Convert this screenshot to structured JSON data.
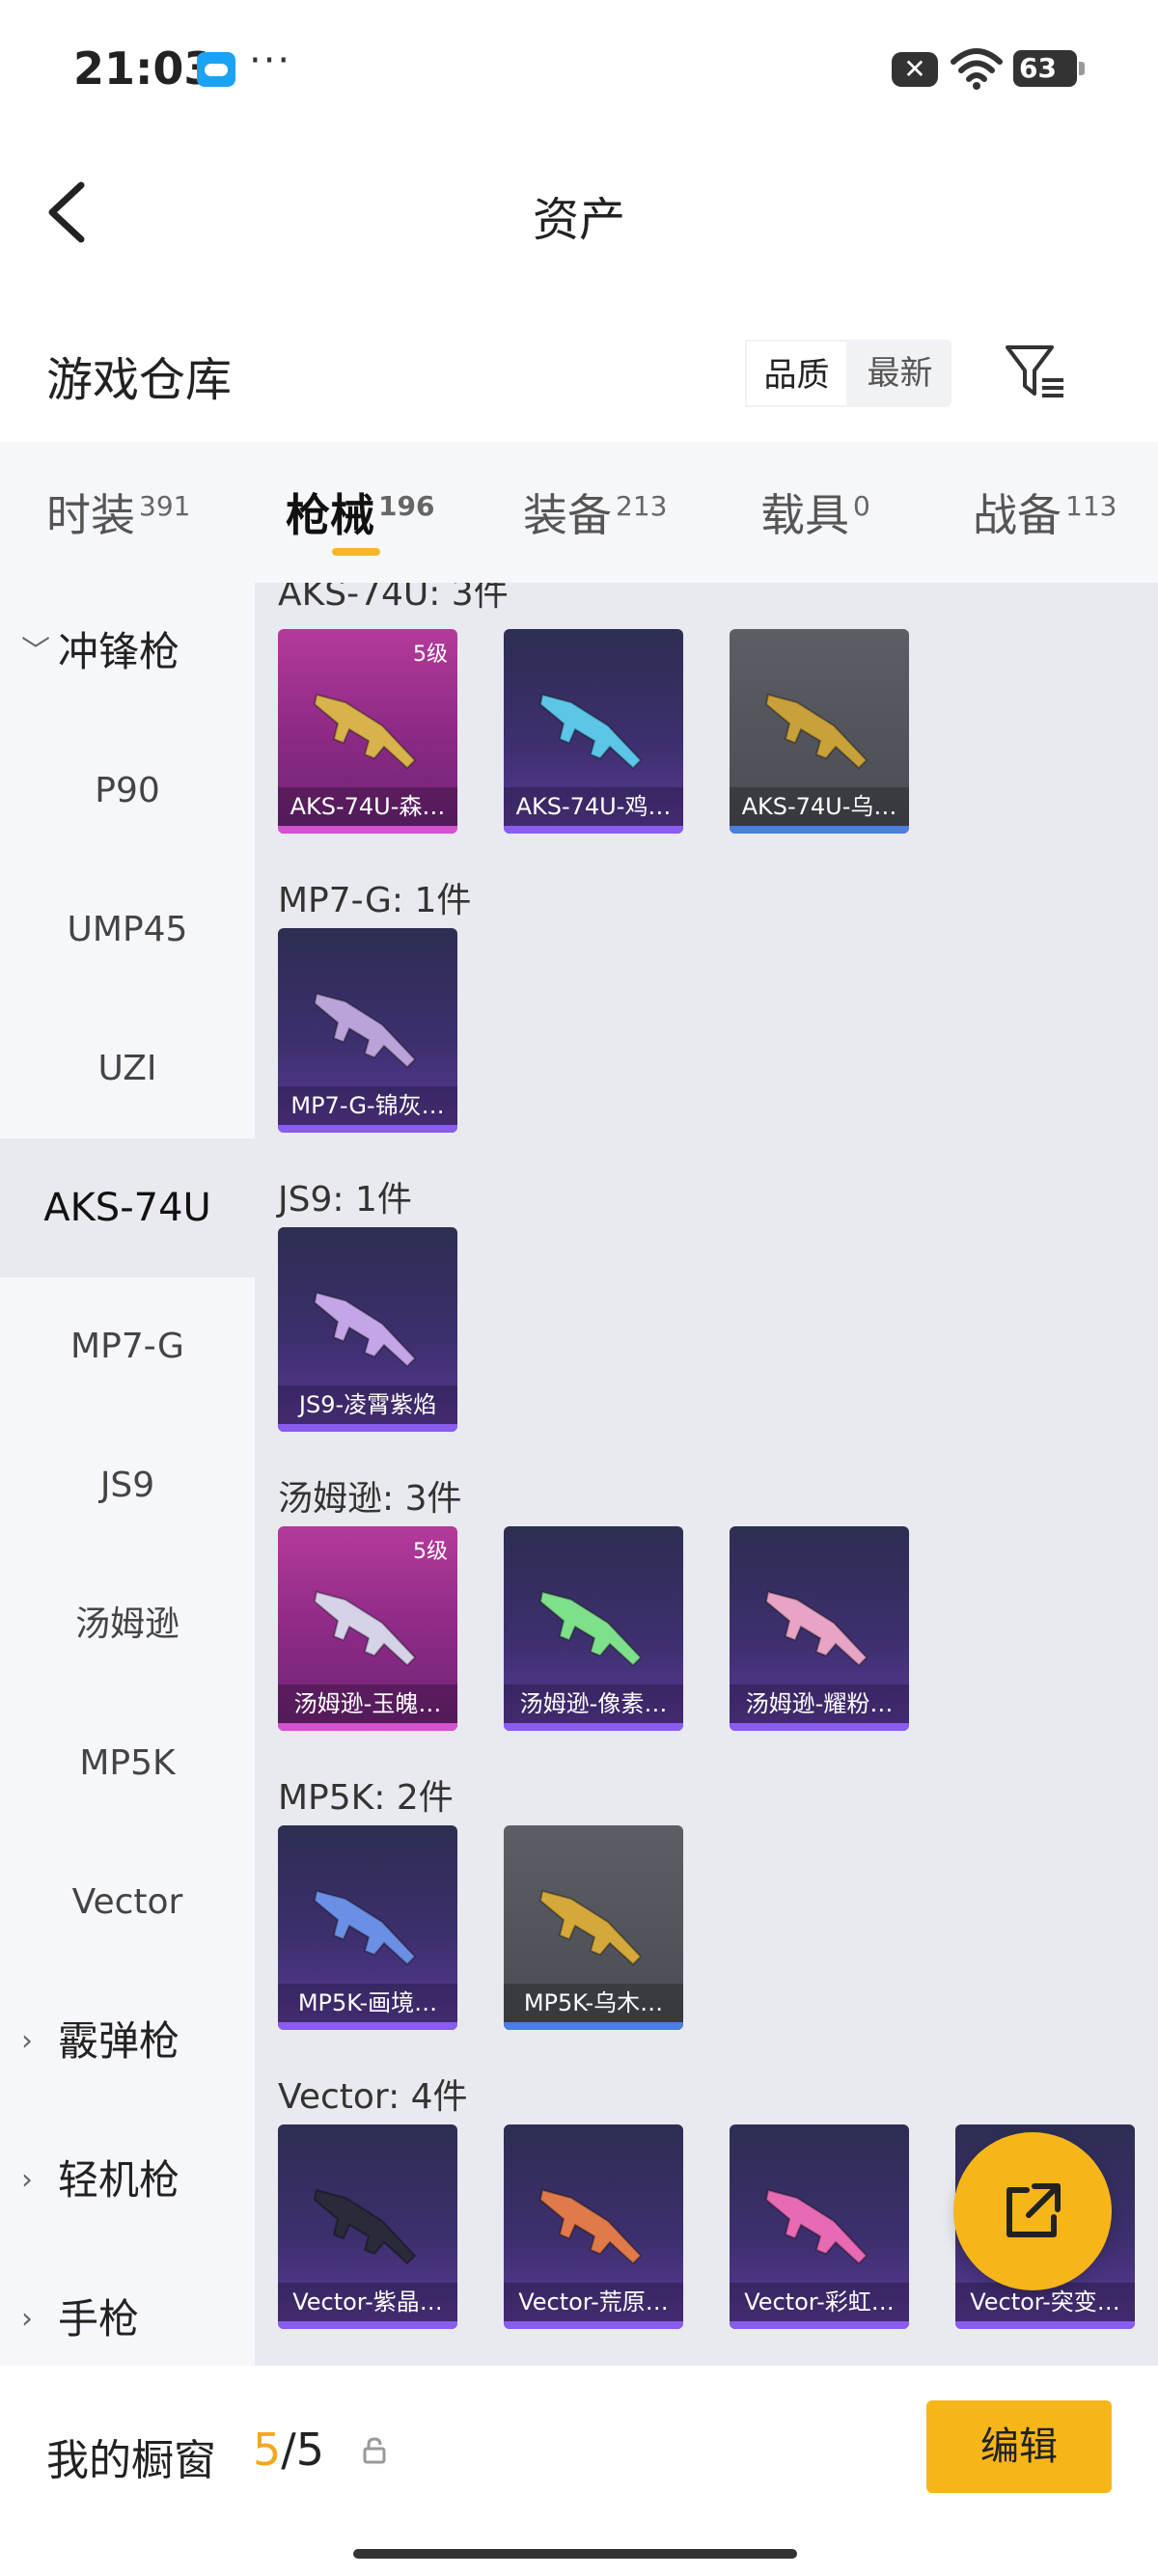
{
  "status_bar": {
    "time": "21:03",
    "more": "···",
    "battery": "63"
  },
  "header": {
    "title": "资产"
  },
  "warehouse": {
    "title": "游戏仓库",
    "sort_options": [
      "品质",
      "最新"
    ]
  },
  "tabs": [
    {
      "label": "时装",
      "count": "391"
    },
    {
      "label": "枪械",
      "count": "196"
    },
    {
      "label": "装备",
      "count": "213"
    },
    {
      "label": "载具",
      "count": "0"
    },
    {
      "label": "战备",
      "count": "113"
    }
  ],
  "sidebar": {
    "groups": {
      "smg": "冲锋枪",
      "shotgun": "霰弹枪",
      "lmg": "轻机枪",
      "pistol": "手枪"
    },
    "items": [
      "P90",
      "UMP45",
      "UZI",
      "AKS-74U",
      "MP7-G",
      "JS9",
      "汤姆逊",
      "MP5K",
      "Vector"
    ]
  },
  "sections": [
    {
      "label": "AKS-74U: 3件",
      "cards": [
        {
          "name": "AKS-74U-森…",
          "level": "5级",
          "rarity": "pink",
          "gun_color": "#d8b24a"
        },
        {
          "name": "AKS-74U-鸡…",
          "level": "",
          "rarity": "purple",
          "gun_color": "#5cc6e8"
        },
        {
          "name": "AKS-74U-乌…",
          "level": "",
          "rarity": "gray",
          "gun_color": "#c9a13a"
        }
      ]
    },
    {
      "label": "MP7-G: 1件",
      "cards": [
        {
          "name": "MP7-G-锦灰…",
          "level": "",
          "rarity": "purple",
          "gun_color": "#b9a3d8"
        }
      ]
    },
    {
      "label": "JS9: 1件",
      "cards": [
        {
          "name": "JS9-凌霄紫焰",
          "level": "",
          "rarity": "purple",
          "gun_color": "#c4a6e8"
        }
      ]
    },
    {
      "label": "汤姆逊: 3件",
      "cards": [
        {
          "name": "汤姆逊-玉魄…",
          "level": "5级",
          "rarity": "pink",
          "gun_color": "#d6d2e8"
        },
        {
          "name": "汤姆逊-像素…",
          "level": "",
          "rarity": "purple",
          "gun_color": "#7fe08c"
        },
        {
          "name": "汤姆逊-耀粉…",
          "level": "",
          "rarity": "purple",
          "gun_color": "#e8a4c4"
        }
      ]
    },
    {
      "label": "MP5K: 2件",
      "cards": [
        {
          "name": "MP5K-画境…",
          "level": "",
          "rarity": "purple",
          "gun_color": "#6c8fe6"
        },
        {
          "name": "MP5K-乌木…",
          "level": "",
          "rarity": "gray",
          "gun_color": "#d4a83a"
        }
      ]
    },
    {
      "label": "Vector: 4件",
      "cards": [
        {
          "name": "Vector-紫晶…",
          "level": "",
          "rarity": "purple",
          "gun_color": "#2a2a3a"
        },
        {
          "name": "Vector-荒原…",
          "level": "",
          "rarity": "purple",
          "gun_color": "#e07a4a"
        },
        {
          "name": "Vector-彩虹…",
          "level": "",
          "rarity": "purple",
          "gun_color": "#e86ab4"
        },
        {
          "name": "Vector-突变…",
          "level": "",
          "rarity": "purple",
          "gun_color": "#9a7ae0"
        }
      ]
    }
  ],
  "bottom_bar": {
    "showcase_label": "我的橱窗",
    "showcase_used": "5",
    "showcase_total": "/5",
    "edit_label": "编辑"
  },
  "colors": {
    "accent": "#f6b619",
    "tab_underline": "#f7b52c"
  }
}
